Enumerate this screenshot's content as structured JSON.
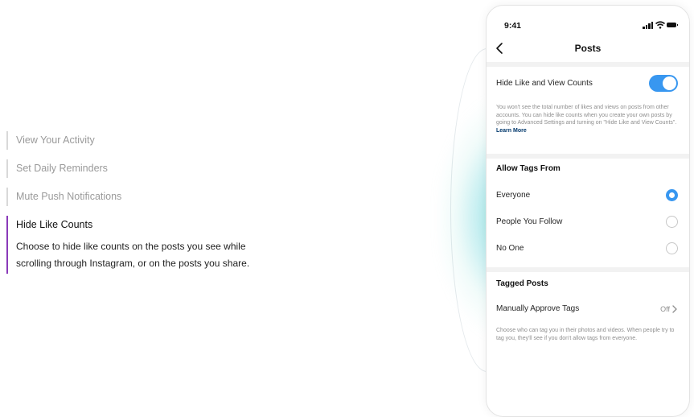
{
  "features": {
    "items": [
      {
        "label": "View Your Activity"
      },
      {
        "label": "Set Daily Reminders"
      },
      {
        "label": "Mute Push Notifications"
      }
    ],
    "active": {
      "title": "Hide Like Counts",
      "description": "Choose to hide like counts on the posts you see while scrolling through Instagram, or on the posts you share."
    }
  },
  "phone": {
    "status_time": "9:41",
    "nav_title": "Posts",
    "hide_counts": {
      "label": "Hide Like and View Counts",
      "enabled": true,
      "note": "You won't see the total number of likes and views on posts from other accounts. You can hide like counts when you create your own posts by going to Advanced Settings and turning on \"Hide Like and View Counts\".",
      "note_link": "Learn More"
    },
    "allow_tags": {
      "heading": "Allow Tags From",
      "options": [
        {
          "label": "Everyone",
          "selected": true
        },
        {
          "label": "People You Follow",
          "selected": false
        },
        {
          "label": "No One",
          "selected": false
        }
      ]
    },
    "tagged_posts": {
      "heading": "Tagged Posts",
      "manual_label": "Manually Approve Tags",
      "manual_value": "Off",
      "note": "Choose who can tag you in their photos and videos. When people try to tag you, they'll see if you don't allow tags from everyone."
    },
    "accent_color": "#3897f0"
  },
  "icons": {
    "back": "chevron-left-icon",
    "chevron": "chevron-right-icon",
    "signal": "cellular-signal-icon",
    "wifi": "wifi-icon",
    "battery": "battery-icon"
  }
}
